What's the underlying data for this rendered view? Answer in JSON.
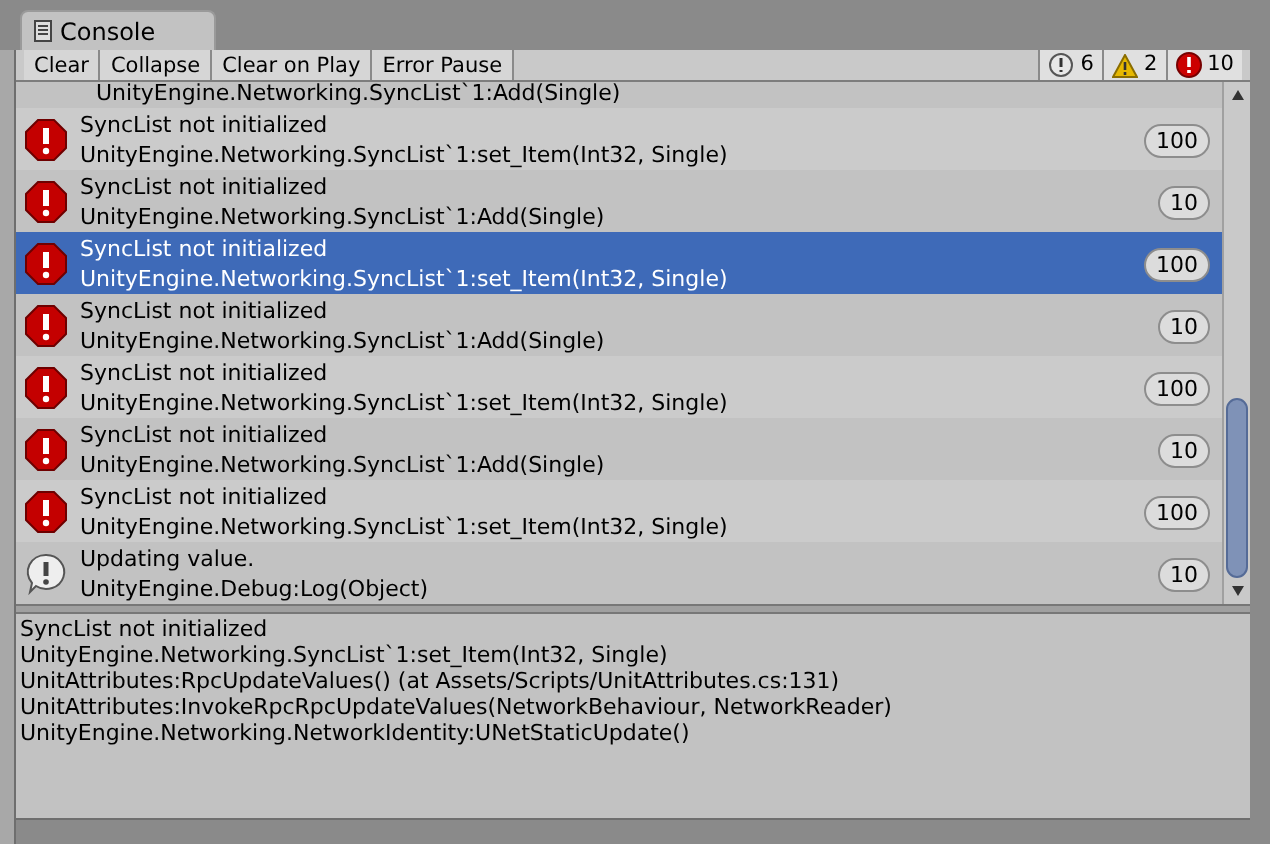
{
  "tab": {
    "title": "Console"
  },
  "toolbar": {
    "buttons": [
      "Clear",
      "Collapse",
      "Clear on Play",
      "Error Pause"
    ],
    "counters": [
      {
        "kind": "log",
        "count": "6"
      },
      {
        "kind": "warning",
        "count": "2"
      },
      {
        "kind": "error",
        "count": "10"
      }
    ]
  },
  "partial_row": {
    "text": "UnityEngine.Networking.SyncList`1:Add(Single)"
  },
  "entries": [
    {
      "kind": "error",
      "message": "SyncList not initialized",
      "source": "UnityEngine.Networking.SyncList`1:set_Item(Int32, Single)",
      "count": "100",
      "selected": false
    },
    {
      "kind": "error",
      "message": "SyncList not initialized",
      "source": "UnityEngine.Networking.SyncList`1:Add(Single)",
      "count": "10",
      "selected": false
    },
    {
      "kind": "error",
      "message": "SyncList not initialized",
      "source": "UnityEngine.Networking.SyncList`1:set_Item(Int32, Single)",
      "count": "100",
      "selected": true
    },
    {
      "kind": "error",
      "message": "SyncList not initialized",
      "source": "UnityEngine.Networking.SyncList`1:Add(Single)",
      "count": "10",
      "selected": false
    },
    {
      "kind": "error",
      "message": "SyncList not initialized",
      "source": "UnityEngine.Networking.SyncList`1:set_Item(Int32, Single)",
      "count": "100",
      "selected": false
    },
    {
      "kind": "error",
      "message": "SyncList not initialized",
      "source": "UnityEngine.Networking.SyncList`1:Add(Single)",
      "count": "10",
      "selected": false
    },
    {
      "kind": "error",
      "message": "SyncList not initialized",
      "source": "UnityEngine.Networking.SyncList`1:set_Item(Int32, Single)",
      "count": "100",
      "selected": false
    },
    {
      "kind": "log",
      "message": "Updating value.",
      "source": "UnityEngine.Debug:Log(Object)",
      "count": "10",
      "selected": false
    }
  ],
  "details": [
    "SyncList not initialized",
    "UnityEngine.Networking.SyncList`1:set_Item(Int32, Single)",
    "UnitAttributes:RpcUpdateValues() (at Assets/Scripts/UnitAttributes.cs:131)",
    "UnitAttributes:InvokeRpcRpcUpdateValues(NetworkBehaviour, NetworkReader)",
    "UnityEngine.Networking.NetworkIdentity:UNetStaticUpdate()"
  ]
}
